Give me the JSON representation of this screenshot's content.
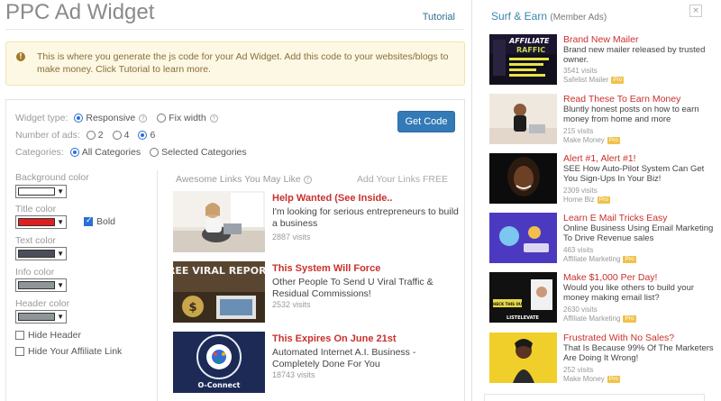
{
  "header": {
    "title": "PPC Ad Widget",
    "tutorial_label": "Tutorial"
  },
  "info": {
    "text": "This is where you generate the js code for your Ad Widget. Add this code to your websites/blogs to make money. Click Tutorial to learn more."
  },
  "options": {
    "widget_type_label": "Widget type:",
    "widget_type_options": [
      "Responsive",
      "Fix width"
    ],
    "widget_type_selected": "Responsive",
    "num_ads_label": "Number of ads:",
    "num_ads_options": [
      "2",
      "4",
      "6"
    ],
    "num_ads_selected": "6",
    "categories_label": "Categories:",
    "categories_options": [
      "All Categories",
      "Selected Categories"
    ],
    "categories_selected": "All Categories",
    "get_code_label": "Get Code"
  },
  "colors": {
    "background_label": "Background color",
    "background_value": "#ffffff",
    "title_label": "Title color",
    "title_value": "#e01f1f",
    "bold_label": "Bold",
    "bold_checked": true,
    "text_label": "Text color",
    "text_value": "#4a4f5a",
    "info_label": "Info color",
    "info_value": "#8f9698",
    "header_label": "Header color",
    "header_value": "#8f9698",
    "hide_header_label": "Hide Header",
    "hide_affiliate_label": "Hide Your Affiliate Link"
  },
  "preview": {
    "title": "Awesome Links You May Like",
    "add_links_label": "Add Your Links FREE",
    "ads": [
      {
        "title": "Help Wanted (See Inside..",
        "desc": "I'm looking for serious entrepreneurs to build a business",
        "visits": "2887 visits"
      },
      {
        "title": "This System Will Force",
        "desc": "Other People To Send U Viral Traffic & Residual Commissions!",
        "visits": "2532 visits"
      },
      {
        "title": "This Expires On June 21st",
        "desc": "Automated Internet A.I. Business - Completely Done For You",
        "visits": "18743 visits"
      }
    ]
  },
  "sidebar": {
    "title": "Surf & Earn",
    "subtitle": "(Member Ads)",
    "close_icon": "×",
    "ads": [
      {
        "title": "Brand New Mailer",
        "desc": "Brand new mailer released by trusted owner.",
        "visits": "3541 visits",
        "source": "Safelist Mailer",
        "badge": "Pro",
        "img_text_1": "AFFILIATE",
        "img_text_2": "RAFFIC"
      },
      {
        "title": "Read These To Earn Money",
        "desc": "Bluntly honest posts on how to earn money from home and more",
        "visits": "215 visits",
        "source": "Make Money",
        "badge": "Pro"
      },
      {
        "title": "Alert #1, Alert #1!",
        "desc": "SEE How Auto-Pilot System Can Get You Sign-Ups In Your Biz!",
        "visits": "2309 visits",
        "source": "Home Biz",
        "badge": "Pro"
      },
      {
        "title": "Learn E Mail Tricks Easy",
        "desc": "Online Business Using Email Marketing To Drive Revenue sales",
        "visits": "463 visits",
        "source": "Affiliate Marketing",
        "badge": "Pro"
      },
      {
        "title": "Make $1,000 Per Day!",
        "desc": "Would you like others to build your money making email list?",
        "visits": "2630 visits",
        "source": "Affiliate Marketing",
        "badge": "Pro",
        "img_text_1": "CHECK THIS OUT",
        "img_text_2": "LISTELEVATE"
      },
      {
        "title": "Frustrated With No Sales?",
        "desc": "That Is Because 99% Of The Marketers Are Doing It Wrong!",
        "visits": "252 visits",
        "source": "Make Money",
        "badge": "Pro"
      }
    ]
  },
  "ad_images": {
    "ad1_text": "FREE VIRAL REPORT!",
    "ad2_text": "O-Connect"
  }
}
